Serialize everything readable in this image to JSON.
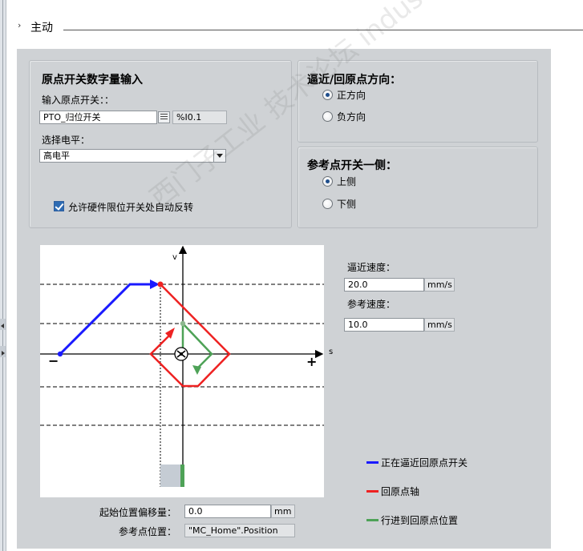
{
  "section": {
    "chevron": "›",
    "title": "主动"
  },
  "home_switch": {
    "title": "原点开关数字量输入",
    "input_label": "输入原点开关：：",
    "input_value": "PTO_归位开关",
    "address": "%I0.1",
    "level_label": "选择电平：",
    "level_value": "高电平",
    "auto_reverse_label": "允许硬件限位开关处自动反转",
    "auto_reverse_checked": true
  },
  "approach_direction": {
    "title": "逼近/回原点方向：",
    "options": [
      {
        "label": "正方向",
        "selected": true
      },
      {
        "label": "负方向",
        "selected": false
      }
    ]
  },
  "reference_side": {
    "title": "参考点开关一侧：",
    "options": [
      {
        "label": "上侧",
        "selected": true
      },
      {
        "label": "下侧",
        "selected": false
      }
    ]
  },
  "diagram": {
    "v_axis": "v",
    "s_axis": "s",
    "minus": "−",
    "plus": "+"
  },
  "speeds": {
    "approach_label": "逼近速度：",
    "approach_value": "20.0",
    "approach_unit": "mm/s",
    "reference_label": "参考速度：",
    "reference_value": "10.0",
    "reference_unit": "mm/s"
  },
  "legend": [
    {
      "label": "正在逼近回原点开关",
      "color": "#1a1aff"
    },
    {
      "label": "回原点轴",
      "color": "#ee2222"
    },
    {
      "label": "行进到回原点位置",
      "color": "#4ea257"
    }
  ],
  "offset": {
    "label": "起始位置偏移量：",
    "value": "0.0",
    "unit": "mm"
  },
  "reference_position": {
    "label": "参考点位置：",
    "value": "\"MC_Home\".Position"
  },
  "watermark": "西门子工业 技术论坛 industry.siemens.com/cs"
}
